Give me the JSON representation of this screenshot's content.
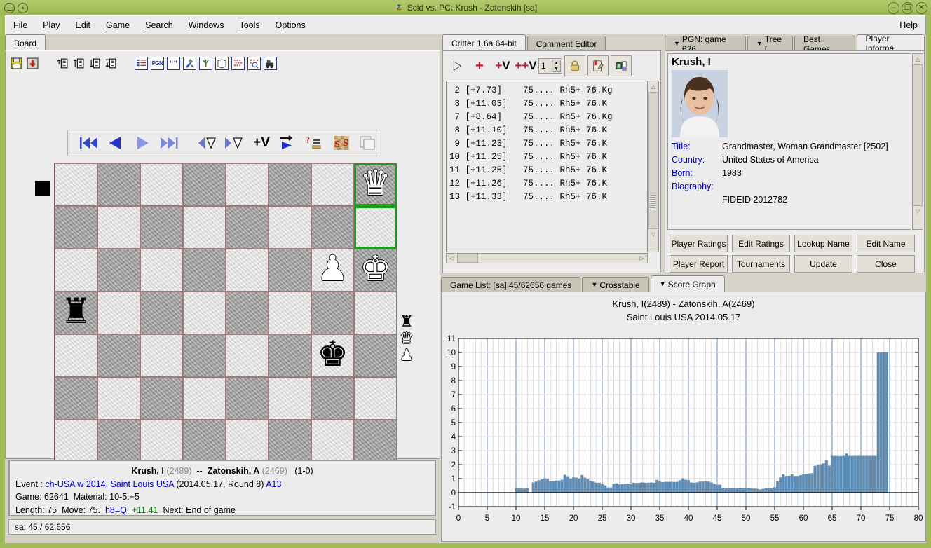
{
  "window": {
    "title": "Scid vs. PC: Krush - Zatonskih [sa]",
    "minimize": "–",
    "maximize": "☐",
    "close": "✕"
  },
  "menu": {
    "items": [
      {
        "pre": "",
        "key": "F",
        "post": "ile"
      },
      {
        "pre": "",
        "key": "P",
        "post": "lay"
      },
      {
        "pre": "",
        "key": "E",
        "post": "dit"
      },
      {
        "pre": "",
        "key": "G",
        "post": "ame"
      },
      {
        "pre": "",
        "key": "S",
        "post": "earch"
      },
      {
        "pre": "",
        "key": "W",
        "post": "indows"
      },
      {
        "pre": "",
        "key": "T",
        "post": "ools"
      },
      {
        "pre": "",
        "key": "O",
        "post": "ptions"
      }
    ],
    "help": {
      "pre": "H",
      "key": "e",
      "post": "lp"
    }
  },
  "board_panel": {
    "tab_label": "Board",
    "toolbar_icons": [
      "save-icon",
      "save-as-icon",
      "add-game-before-icon",
      "add-game-icon",
      "move-down-icon",
      "move-bottom-icon",
      "game-list-icon",
      "pgn-icon",
      "comment-icon",
      "analysis-tools-icon",
      "tree-icon",
      "book-icon",
      "crosstable-icon",
      "finder-icon",
      "engine-icon"
    ],
    "nav_icons": [
      "first-move-icon",
      "previous-move-icon",
      "next-move-icon",
      "last-move-icon",
      "previous-variation-icon",
      "next-variation-icon",
      "add-variation-icon",
      "autoplay-icon",
      "annotate-icon",
      "flip-board-icon",
      "copy-board-icon"
    ]
  },
  "chess": {
    "highlight_from": "h8",
    "highlight_to": "h7",
    "pieces": [
      {
        "square": "h8",
        "glyph": "♛",
        "color": "w",
        "name": "white-queen"
      },
      {
        "square": "g6",
        "glyph": "♟",
        "color": "w",
        "name": "white-pawn"
      },
      {
        "square": "h6",
        "glyph": "♚",
        "color": "w",
        "name": "white-king"
      },
      {
        "square": "a5",
        "glyph": "♜",
        "color": "b",
        "name": "black-rook"
      },
      {
        "square": "g4",
        "glyph": "♚",
        "color": "b",
        "name": "black-king"
      }
    ],
    "captured": [
      {
        "glyph": "♜",
        "color": "black",
        "name": "captured-black-rook"
      },
      {
        "glyph": "♛",
        "color": "white",
        "name": "captured-white-queen"
      },
      {
        "glyph": "♟",
        "color": "white",
        "name": "captured-white-pawn"
      }
    ]
  },
  "game_info": {
    "white": "Krush, I",
    "white_elo": "(2489)",
    "dash": "--",
    "black": "Zatonskih, A",
    "black_elo": "(2469)",
    "result": "(1-0)",
    "event_label": "Event :",
    "event_name": "ch-USA w 2014, Saint Louis USA",
    "event_detail": "(2014.05.17, Round 8)",
    "eco": "A13",
    "game_label": "Game:",
    "game_number": "62641",
    "material_label": "Material:",
    "material_value": "10-5:+5",
    "length_label": "Length:",
    "length_value": "75",
    "move_label": "Move:",
    "move_number": "75.",
    "move_san": "h8=Q",
    "move_score": "+11.41",
    "next_label": "Next:",
    "next_value": "End of game"
  },
  "status_bar": {
    "text": "sa:  45 / 62,656"
  },
  "engine": {
    "tabs": [
      {
        "label": "Critter 1.6a 64-bit",
        "active": true
      },
      {
        "label": "Comment Editor",
        "active": false
      }
    ],
    "toolbar": {
      "start": "start-analysis-icon",
      "add_move": "+",
      "add_var": "+V",
      "add_all_var": "++V",
      "lines_value": "1",
      "lock_icon": "lock-icon",
      "annotate_icon": "annotate-icon",
      "config_icon": "engine-config-icon"
    },
    "lines": [
      {
        "depth": "2",
        "score": "[+7.73]",
        "pv": "75.... Rh5+ 76.Kg"
      },
      {
        "depth": "3",
        "score": "[+11.03]",
        "pv": "75.... Rh5+ 76.K"
      },
      {
        "depth": "7",
        "score": "[+8.64]",
        "pv": "75.... Rh5+ 76.Kg"
      },
      {
        "depth": "8",
        "score": "[+11.10]",
        "pv": "75.... Rh5+ 76.K"
      },
      {
        "depth": "9",
        "score": "[+11.23]",
        "pv": "75.... Rh5+ 76.K"
      },
      {
        "depth": "10",
        "score": "[+11.25]",
        "pv": "75.... Rh5+ 76.K"
      },
      {
        "depth": "11",
        "score": "[+11.25]",
        "pv": "75.... Rh5+ 76.K"
      },
      {
        "depth": "12",
        "score": "[+11.26]",
        "pv": "75.... Rh5+ 76.K"
      },
      {
        "depth": "13",
        "score": "[+11.33]",
        "pv": "75.... Rh5+ 76.K"
      }
    ]
  },
  "player_info": {
    "tabs": [
      {
        "label": "PGN: game 626",
        "dropdown": true,
        "active": false
      },
      {
        "label": "Tree [",
        "dropdown": true,
        "active": false
      },
      {
        "label": "Best Games",
        "dropdown": false,
        "active": false
      },
      {
        "label": "Player Informa",
        "dropdown": false,
        "active": true
      }
    ],
    "name": "Krush, I",
    "fields": [
      {
        "label": "Title:",
        "value": "Grandmaster,  Woman Grandmaster  [2502]"
      },
      {
        "label": "Country:",
        "value": "United States of America"
      },
      {
        "label": "Born:",
        "value": "1983"
      },
      {
        "label": "Biography:",
        "value": ""
      }
    ],
    "biography_line": "FIDEID 2012782",
    "buttons": [
      "Player Ratings",
      "Edit Ratings",
      "Lookup Name",
      "Edit Name",
      "Player Report",
      "Tournaments",
      "Update",
      "Close"
    ]
  },
  "bottom_tabs": [
    {
      "label": "Game List: [sa] 45/62656 games",
      "dropdown": false,
      "active": false
    },
    {
      "label": "Crosstable",
      "dropdown": true,
      "active": false
    },
    {
      "label": "Score Graph",
      "dropdown": true,
      "active": true
    }
  ],
  "chart_data": {
    "type": "bar",
    "title": "Krush, I(2489) - Zatonskih, A(2469)",
    "subtitle": "Saint Louis USA  2014.05.17",
    "xlabel": "",
    "ylabel": "",
    "xlim": [
      0,
      80
    ],
    "ylim": [
      -1,
      11
    ],
    "xticks": [
      0,
      5,
      10,
      15,
      20,
      25,
      30,
      35,
      40,
      45,
      50,
      55,
      60,
      65,
      70,
      75,
      80
    ],
    "yticks": [
      -1,
      0,
      1,
      2,
      3,
      4,
      5,
      6,
      7,
      8,
      9,
      10,
      11
    ],
    "grid": true,
    "legend": "none",
    "bar_color": "#5b8db8",
    "x": [
      10,
      10.5,
      11,
      11.5,
      12,
      12.5,
      13,
      13.5,
      14,
      14.5,
      15,
      15.5,
      16,
      16.5,
      17,
      17.5,
      18,
      18.5,
      19,
      19.5,
      20,
      20.5,
      21,
      21.5,
      22,
      22.5,
      23,
      23.5,
      24,
      24.5,
      25,
      25.5,
      26,
      26.5,
      27,
      27.5,
      28,
      28.5,
      29,
      29.5,
      30,
      30.5,
      31,
      31.5,
      32,
      32.5,
      33,
      33.5,
      34,
      34.5,
      35,
      35.5,
      36,
      36.5,
      37,
      37.5,
      38,
      38.5,
      39,
      39.5,
      40,
      40.5,
      41,
      41.5,
      42,
      42.5,
      43,
      43.5,
      44,
      44.5,
      45,
      45.5,
      46,
      46.5,
      47,
      47.5,
      48,
      48.5,
      49,
      49.5,
      50,
      50.5,
      51,
      51.5,
      52,
      52.5,
      53,
      53.5,
      54,
      54.5,
      55,
      55.5,
      56,
      56.5,
      57,
      57.5,
      58,
      58.5,
      59,
      59.5,
      60,
      60.5,
      61,
      61.5,
      62,
      62.5,
      63,
      63.5,
      64,
      64.5,
      65,
      65.5,
      66,
      66.5,
      67,
      67.5,
      68,
      68.5,
      69,
      69.5,
      70,
      70.5,
      71,
      71.5,
      72,
      72.5,
      73,
      73.5,
      74,
      74.5,
      75
    ],
    "values": [
      0.3,
      0.3,
      0.3,
      0.28,
      0.32,
      0.02,
      0.72,
      0.78,
      0.88,
      0.95,
      1.02,
      0.98,
      0.8,
      0.82,
      0.85,
      0.86,
      0.92,
      1.27,
      1.16,
      1.0,
      1.08,
      1.06,
      1.0,
      1.25,
      1.06,
      0.97,
      0.82,
      0.78,
      0.7,
      0.7,
      0.62,
      0.52,
      0.36,
      0.36,
      0.62,
      0.66,
      0.58,
      0.6,
      0.62,
      0.64,
      0.58,
      0.7,
      0.68,
      0.7,
      0.72,
      0.7,
      0.7,
      0.72,
      0.7,
      0.9,
      0.82,
      0.74,
      0.76,
      0.76,
      0.76,
      0.75,
      0.76,
      0.88,
      1.02,
      0.92,
      0.88,
      0.72,
      0.7,
      0.72,
      0.78,
      0.78,
      0.8,
      0.78,
      0.72,
      0.62,
      0.56,
      0.56,
      0.34,
      0.3,
      0.3,
      0.3,
      0.3,
      0.3,
      0.34,
      0.32,
      0.32,
      0.34,
      0.3,
      0.28,
      0.26,
      0.22,
      0.26,
      0.34,
      0.3,
      0.3,
      0.38,
      0.82,
      1.08,
      1.3,
      1.18,
      1.2,
      1.3,
      1.18,
      1.18,
      1.24,
      1.3,
      1.32,
      1.36,
      1.38,
      1.9,
      2.0,
      2.02,
      2.08,
      2.32,
      1.92,
      2.62,
      2.62,
      2.6,
      2.6,
      2.62,
      2.78,
      2.62,
      2.62,
      2.62,
      2.62,
      2.62,
      2.62,
      2.62,
      2.62,
      2.62,
      2.62,
      10.0,
      10.0,
      10.0,
      10.0
    ]
  }
}
